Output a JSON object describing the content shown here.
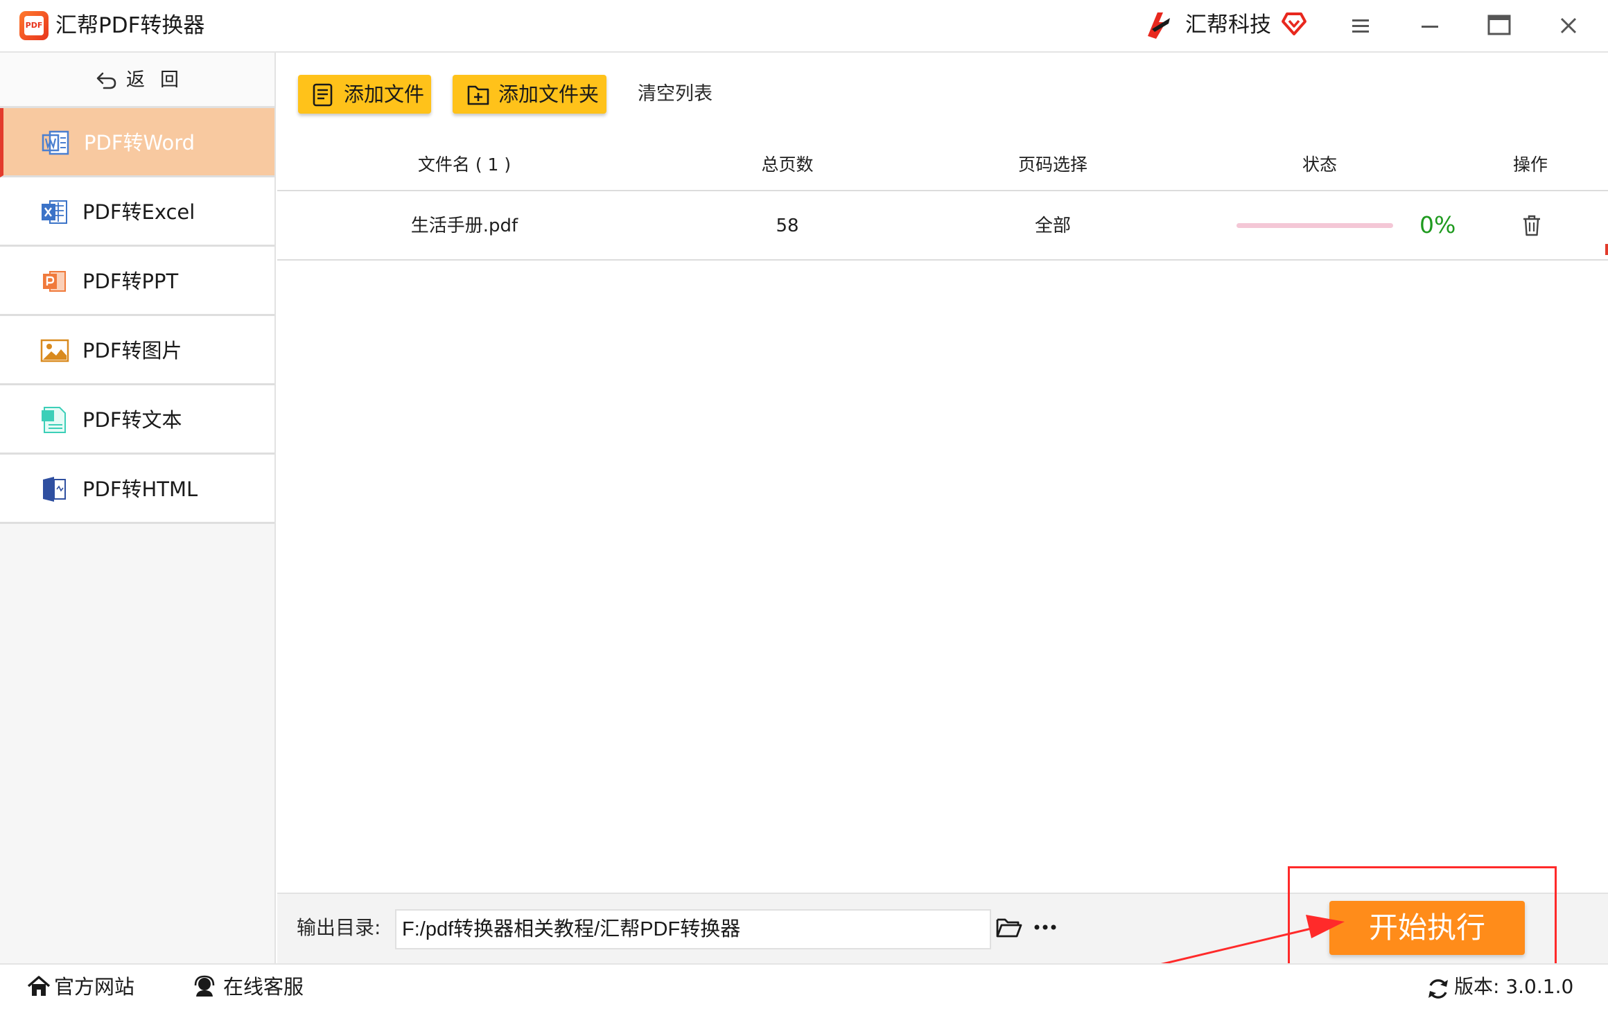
{
  "app": {
    "title": "汇帮PDF转换器",
    "logo_text": "PDF",
    "brand_name": "汇帮科技"
  },
  "icons": {
    "app_logo": "pdf-app-icon",
    "brand_logo": "huibang-logo-icon",
    "vip": "heart-diamond-icon",
    "menu": "hamburger-menu-icon",
    "minimize": "minimize-icon",
    "maximize": "maximize-icon",
    "close": "close-icon"
  },
  "sidebar": {
    "back_label": "返回",
    "items": [
      {
        "label": "PDF转Word",
        "icon": "word-icon",
        "active": true
      },
      {
        "label": "PDF转Excel",
        "icon": "excel-icon",
        "active": false
      },
      {
        "label": "PDF转PPT",
        "icon": "ppt-icon",
        "active": false
      },
      {
        "label": "PDF转图片",
        "icon": "image-icon",
        "active": false
      },
      {
        "label": "PDF转文本",
        "icon": "text-icon",
        "active": false
      },
      {
        "label": "PDF转HTML",
        "icon": "html-icon",
        "active": false
      }
    ]
  },
  "toolbar": {
    "add_file": "添加文件",
    "add_folder": "添加文件夹",
    "clear_list": "清空列表"
  },
  "table": {
    "columns": [
      "文件名 ( 1 )",
      "总页数",
      "页码选择",
      "状态",
      "操作"
    ],
    "rows": [
      {
        "filename": "生活手册.pdf",
        "pages": "58",
        "range": "全部",
        "progress": 0,
        "progress_text": "0%"
      }
    ]
  },
  "output": {
    "label": "输出目录:",
    "path": "F:/pdf转换器相关教程/汇帮PDF转换器"
  },
  "start_button": "开始执行",
  "statusbar": {
    "website": "官方网站",
    "support": "在线客服",
    "version": "版本:  3.0.1.0"
  },
  "colors": {
    "accent_yellow": "#ffc21a",
    "active_nav": "#f8c9a0",
    "active_marker": "#e33b2c",
    "start_button": "#ff8c1a",
    "progress_text": "#1e9a1e",
    "annotation_red": "#ff2a2a"
  }
}
